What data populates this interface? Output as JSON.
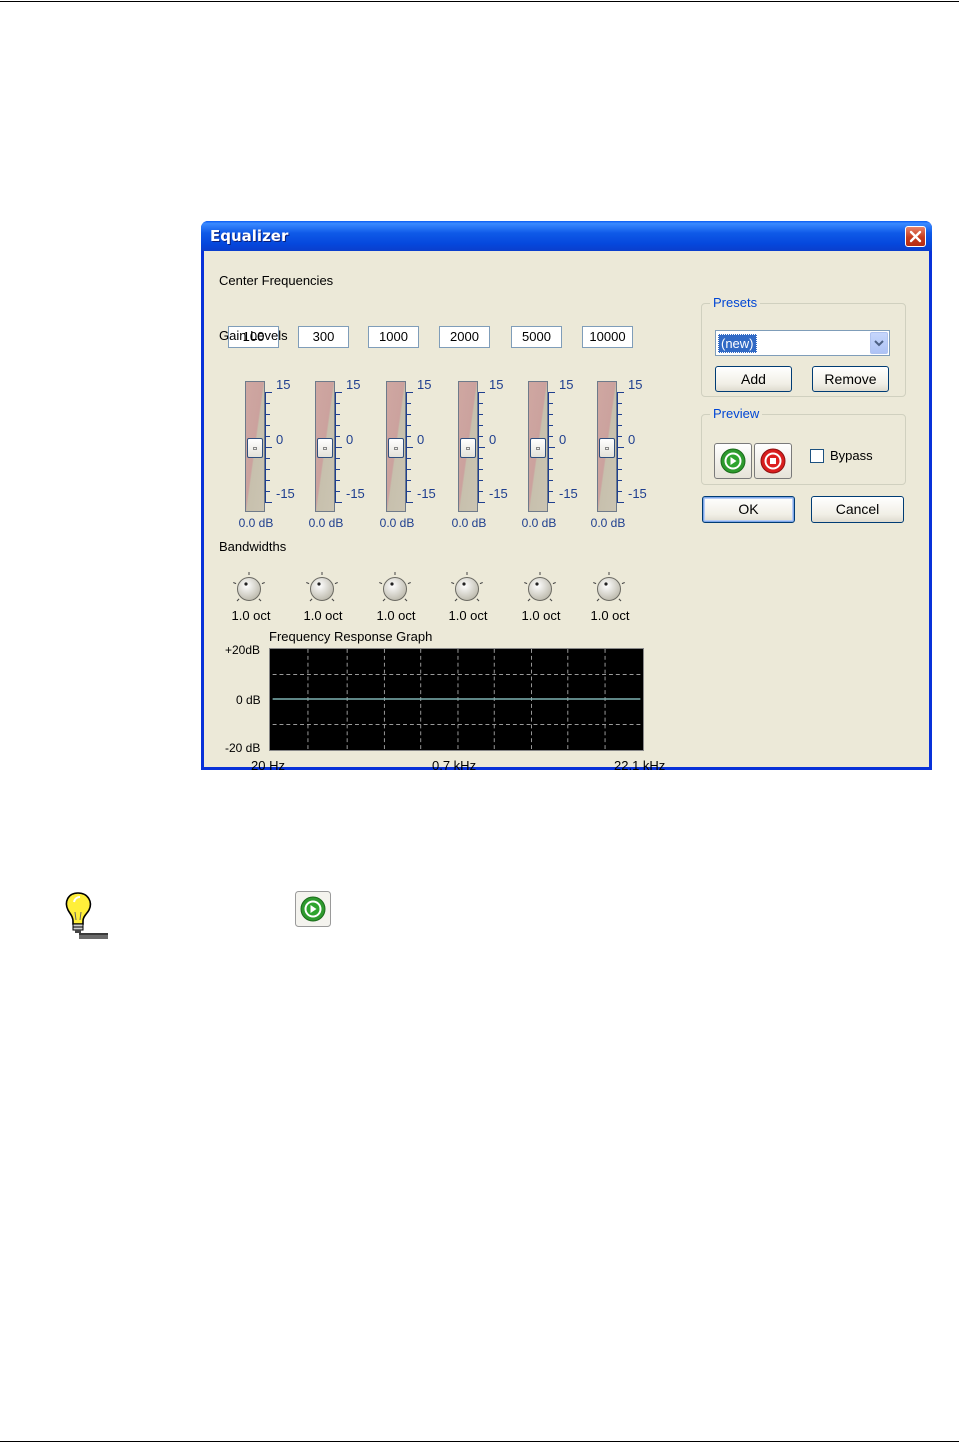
{
  "window": {
    "title": "Equalizer"
  },
  "center_frequencies": {
    "label": "Center Frequencies",
    "values": [
      "100",
      "300",
      "1000",
      "2000",
      "5000",
      "10000"
    ]
  },
  "gain_levels": {
    "label": "Gain Levels",
    "scale_top": "15",
    "scale_mid": "0",
    "scale_bottom": "-15",
    "values": [
      "0.0 dB",
      "0.0 dB",
      "0.0 dB",
      "0.0 dB",
      "0.0 dB",
      "0.0 dB"
    ],
    "levels_db": [
      0,
      0,
      0,
      0,
      0,
      0
    ]
  },
  "bandwidths": {
    "label": "Bandwidths",
    "values": [
      "1.0 oct",
      "1.0 oct",
      "1.0 oct",
      "1.0 oct",
      "1.0 oct",
      "1.0 oct"
    ]
  },
  "graph": {
    "label": "Frequency Response Graph",
    "y_top": "+20dB",
    "y_mid": "0 dB",
    "y_bottom": "-20 dB",
    "x_left": "20 Hz",
    "x_mid": "0.7 kHz",
    "x_right": "22.1 kHz",
    "line_color": "#7fb2b2"
  },
  "presets": {
    "label": "Presets",
    "selected": "(new)",
    "add_label": "Add",
    "remove_label": "Remove"
  },
  "preview": {
    "label": "Preview",
    "play_icon": "play-icon",
    "stop_icon": "stop-icon",
    "bypass_label": "Bypass",
    "bypass_checked": false
  },
  "buttons": {
    "ok_label": "OK",
    "cancel_label": "Cancel"
  },
  "colors": {
    "title_bar": "#0a5cf3",
    "dialog_bg": "#ece9d8",
    "group_label": "#0046d5"
  },
  "tip": {
    "icon": "lightbulb-icon",
    "inline_icon": "play-icon"
  }
}
